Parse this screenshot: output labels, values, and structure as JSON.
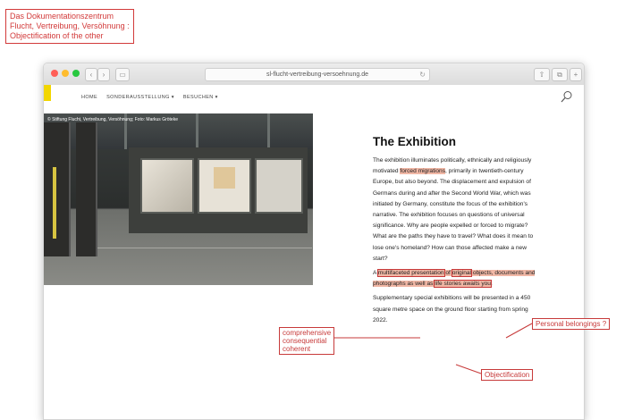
{
  "title_note": [
    "Das Dokumentationszentrum",
    "Flucht, Vertreibung, Versöhnung :",
    "Objectification of the other"
  ],
  "browser": {
    "url": "sl-flucht-vertreibung-versoehnung.de"
  },
  "site": {
    "nav": [
      "HOME",
      "SONDERAUSSTELLUNG ▾",
      "BESUCHEN ▾"
    ]
  },
  "hero": {
    "caption": "© Stiftung Flucht, Vertreibung, Versöhnung; Foto: Markus Gröteke"
  },
  "article": {
    "title": "The Exhibition",
    "p1_a": "The exhibition illuminates politically, ethnically and religiously motivated ",
    "p1_hl": "forced migrations",
    "p1_b": ", primarily in twentieth-century Europe, but also beyond. The displacement and expulsion of Germans during and after the Second World War, which was initiated by Germany, constitute the focus of the exhibition's narrative. The exhibition focuses on questions of universal significance. Why are people expelled or forced to migrate? What are the paths they have to travel? What does it mean to lose one's homeland? How can those affected make a new start?",
    "p2_a": "A ",
    "p2_box1": "multifaceted presentation",
    "p2_b": " of ",
    "p2_box2": "original",
    "p2_c": " objects, documents and photographs as well as ",
    "p2_box3": "life stories awaits you",
    "p2_d": ".",
    "p3": "Supplementary special exhibitions will be presented in a 450 square metre space on the ground floor starting from spring 2022."
  },
  "annotations": {
    "left": [
      "comprehensive",
      "consequential",
      "coherent"
    ],
    "personal": "Personal belongings ?",
    "objectification": "Objectification"
  },
  "colors": {
    "annotation_red": "#c73a3a",
    "highlight": "#f1b7a5",
    "logo_yellow": "#f2d600"
  }
}
